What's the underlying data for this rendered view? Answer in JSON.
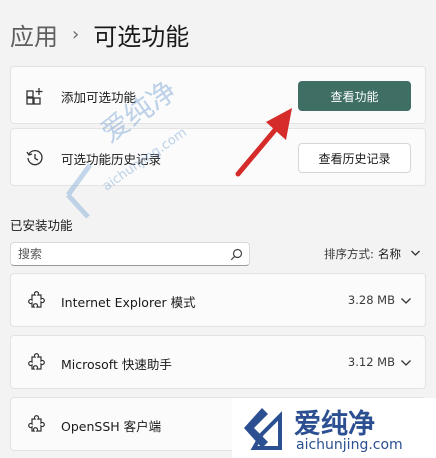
{
  "breadcrumb": {
    "parent": "应用",
    "separator": "›",
    "current": "可选功能"
  },
  "add_feature": {
    "label": "添加可选功能",
    "button_label": "查看功能",
    "icon": "add-square-icon"
  },
  "history": {
    "label": "可选功能历史记录",
    "button_label": "查看历史记录",
    "icon": "history-clock-icon"
  },
  "installed": {
    "section_title": "已安装功能",
    "search_placeholder": "搜索",
    "sort_label": "排序方式:",
    "sort_value": "名称",
    "items": [
      {
        "name": "Internet Explorer 模式",
        "size": "3.28 MB",
        "icon": "puzzle-icon"
      },
      {
        "name": "Microsoft 快速助手",
        "size": "3.12 MB",
        "icon": "puzzle-icon"
      },
      {
        "name": "OpenSSH 客户端",
        "size": "",
        "icon": "puzzle-icon"
      }
    ]
  },
  "watermark": {
    "cn": "爱纯净",
    "en": "aichunjing.com"
  },
  "colors": {
    "accent": "#3e6e64",
    "annotation_arrow": "#d62b2b",
    "watermark": "#2b4f91"
  }
}
